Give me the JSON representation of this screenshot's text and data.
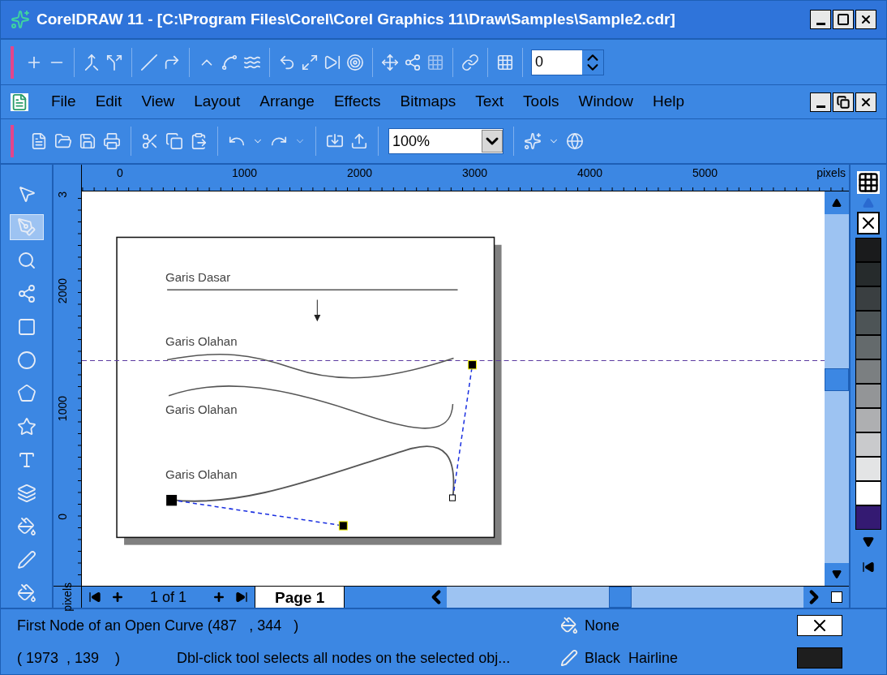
{
  "window": {
    "title": "CorelDRAW 11 - [C:\\Program Files\\Corel\\Corel Graphics 11\\Draw\\Samples\\Sample2.cdr]"
  },
  "property_bar": {
    "field_value": "0"
  },
  "menu": [
    {
      "label": "File"
    },
    {
      "label": "Edit"
    },
    {
      "label": "View"
    },
    {
      "label": "Layout"
    },
    {
      "label": "Arrange"
    },
    {
      "label": "Effects"
    },
    {
      "label": "Bitmaps"
    },
    {
      "label": "Text"
    },
    {
      "label": "Tools"
    },
    {
      "label": "Window"
    },
    {
      "label": "Help"
    }
  ],
  "standard_toolbar": {
    "zoom": "100%"
  },
  "toolbox": [
    {
      "kind": "pick",
      "selected": false
    },
    {
      "kind": "shape",
      "selected": true
    },
    {
      "kind": "zoom",
      "selected": false
    },
    {
      "kind": "connector",
      "selected": false
    },
    {
      "kind": "rectangle",
      "selected": false
    },
    {
      "kind": "ellipse",
      "selected": false
    },
    {
      "kind": "polygon",
      "selected": false
    },
    {
      "kind": "star",
      "selected": false
    },
    {
      "kind": "text",
      "selected": false
    },
    {
      "kind": "shadow",
      "selected": false
    },
    {
      "kind": "fill",
      "selected": false
    },
    {
      "kind": "pen",
      "selected": false
    },
    {
      "kind": "fill",
      "selected": false
    }
  ],
  "rulers": {
    "horizontal": [
      "0",
      "1000",
      "2000",
      "3000",
      "4000",
      "5000"
    ],
    "horizontal_unit": "pixels",
    "vertical": [
      "3",
      "2000",
      "1000",
      "0"
    ],
    "vertical_unit": "pixels"
  },
  "document": {
    "labels": [
      "Garis Dasar",
      "Garis Olahan",
      "Garis Olahan",
      "Garis Olahan"
    ]
  },
  "page_nav": {
    "count": "1 of 1",
    "tabs": [
      {
        "label": "Page 1",
        "selected": true
      }
    ]
  },
  "palette": [
    {
      "color": "#1a1b1c"
    },
    {
      "color": "#262b2c"
    },
    {
      "color": "#3a3f41"
    },
    {
      "color": "#4d5456"
    },
    {
      "color": "#646a6c"
    },
    {
      "color": "#7b7f81"
    },
    {
      "color": "#939597"
    },
    {
      "color": "#aeafb1"
    },
    {
      "color": "#c9cacc"
    },
    {
      "color": "#e3e4e5"
    },
    {
      "color": "#ffffff"
    },
    {
      "color": "#341a72"
    }
  ],
  "status_bar": {
    "object_info": "First Node of an Open Curve (487   , 344   )",
    "coordinates": "( 1973  , 139    )",
    "hint": "Dbl-click tool selects all nodes on the selected obj...",
    "fill": "None",
    "outline": "Black  Hairline"
  }
}
